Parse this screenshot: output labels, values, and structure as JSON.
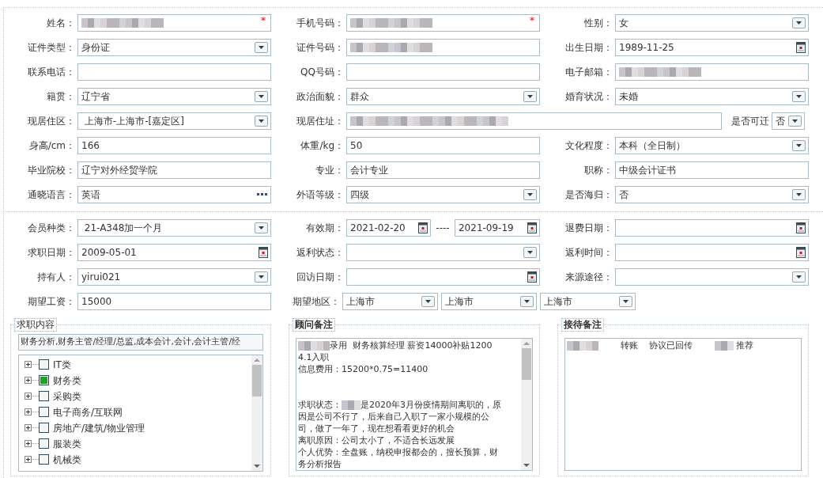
{
  "sections": [
    {
      "rows": [
        {
          "fields": [
            {
              "label": "姓名：",
              "kind": "text",
              "redacted": true,
              "required_mark": "*"
            },
            {
              "label": "手机号码：",
              "kind": "text",
              "redacted": true,
              "required_mark": "*"
            },
            {
              "label": "性别：",
              "kind": "select",
              "value": "女"
            }
          ]
        },
        {
          "fields": [
            {
              "label": "证件类型：",
              "kind": "select",
              "value": "身份证"
            },
            {
              "label": "证件号码：",
              "kind": "text",
              "redacted": true
            },
            {
              "label": "出生日期：",
              "kind": "date",
              "value": "1989-11-25"
            }
          ]
        },
        {
          "fields": [
            {
              "label": "联系电话：",
              "kind": "text"
            },
            {
              "label": "QQ号码：",
              "kind": "text"
            },
            {
              "label": "电子邮箱：",
              "kind": "text",
              "redacted": true
            }
          ]
        },
        {
          "fields": [
            {
              "label": "籍贯：",
              "kind": "select",
              "value": "辽宁省"
            },
            {
              "label": "政治面貌：",
              "kind": "select",
              "value": "群众"
            },
            {
              "label": "婚育状况：",
              "kind": "select",
              "value": "未婚"
            }
          ]
        },
        {
          "fields": [
            {
              "label": "现居住区：",
              "kind": "select",
              "value": " 上海市-上海市-[嘉定区]"
            },
            {
              "label": "现居住址：",
              "kind": "wide_text",
              "redacted": true
            },
            {
              "label": "是否可迁",
              "kind": "compact_select",
              "value": "否"
            }
          ]
        },
        {
          "fields": [
            {
              "label": "身高/cm：",
              "kind": "text",
              "value": "166"
            },
            {
              "label": "体重/kg：",
              "kind": "text",
              "value": "50"
            },
            {
              "label": "文化程度：",
              "kind": "select",
              "value": "本科（全日制）"
            }
          ]
        },
        {
          "fields": [
            {
              "label": "毕业院校：",
              "kind": "text",
              "value": "辽宁对外经贸学院"
            },
            {
              "label": "专业：",
              "kind": "text",
              "value": "会计专业"
            },
            {
              "label": "职称：",
              "kind": "text",
              "value": "中级会计证书"
            }
          ]
        },
        {
          "fields": [
            {
              "label": "通晓语言：",
              "kind": "picker",
              "value": "英语"
            },
            {
              "label": "外语等级：",
              "kind": "select",
              "value": "四级"
            },
            {
              "label": "是否海归：",
              "kind": "select",
              "value": "否"
            }
          ]
        }
      ]
    },
    {
      "rows": [
        {
          "fields": [
            {
              "label": "会员种类：",
              "kind": "select",
              "value": " 21-A348加一个月"
            },
            {
              "label": "有效期：",
              "kind": "date_range",
              "values": [
                "2021-02-20",
                "2021-09-19"
              ],
              "separator": "----"
            },
            {
              "label": "退费日期：",
              "kind": "date"
            }
          ]
        },
        {
          "fields": [
            {
              "label": "求职日期：",
              "kind": "date",
              "value": "2009-05-01"
            },
            {
              "label": "返利状态：",
              "kind": "select"
            },
            {
              "label": "返利时间：",
              "kind": "date"
            }
          ]
        },
        {
          "fields": [
            {
              "label": "持有人：",
              "kind": "select",
              "value": "yirui021"
            },
            {
              "label": "回访日期：",
              "kind": "date"
            },
            {
              "label": "来源途径：",
              "kind": "select"
            }
          ]
        },
        {
          "fields": [
            {
              "label": "期望工资：",
              "kind": "text",
              "value": "15000"
            },
            {
              "label": "期望地区：",
              "kind": "multi_select",
              "values": [
                "上海市",
                "上海市",
                "上海市"
              ]
            }
          ]
        }
      ]
    }
  ],
  "job_content": {
    "legend": "求职内容",
    "emphasized": false,
    "summary": "财务分析,财务主管/经理/总监,成本会计,会计,会计主管/经",
    "tree": [
      {
        "label": "IT类",
        "checked": false
      },
      {
        "label": "财务类",
        "checked": true
      },
      {
        "label": "采购类",
        "checked": false
      },
      {
        "label": "电子商务/互联网",
        "checked": false
      },
      {
        "label": "房地产/建筑/物业管理",
        "checked": false
      },
      {
        "label": "服装类",
        "checked": false
      },
      {
        "label": "机械类",
        "checked": false
      }
    ]
  },
  "notes": [
    {
      "legend": "顾问备注",
      "emphasized": true,
      "scrollable": true,
      "paragraphs": [
        {
          "parts": [
            {
              "kind": "redacted"
            },
            {
              "kind": "text",
              "text": "录用  财务核算经理 薪资14000补贴1200"
            }
          ]
        },
        {
          "parts": [
            {
              "kind": "text",
              "text": "4.1入职"
            }
          ]
        },
        {
          "parts": [
            {
              "kind": "text",
              "text": "信息费用：15200*0.75=11400"
            }
          ]
        },
        {
          "parts": [
            {
              "kind": "spacer"
            }
          ]
        },
        {
          "parts": [
            {
              "kind": "spacer"
            }
          ]
        },
        {
          "parts": [
            {
              "kind": "text",
              "text": "求职状态："
            },
            {
              "kind": "redacted"
            },
            {
              "kind": "text",
              "text": "是2020年3月份疫情期间离职的，原"
            }
          ]
        },
        {
          "parts": [
            {
              "kind": "text",
              "text": "因是公司不行了，后来自己入职了一家小规模的公"
            }
          ]
        },
        {
          "parts": [
            {
              "kind": "text",
              "text": "司，做了一年了，现在想看看更好的机会"
            }
          ]
        },
        {
          "parts": [
            {
              "kind": "text",
              "text": "离职原因：公司太小了，不适合长远发展"
            }
          ]
        },
        {
          "parts": [
            {
              "kind": "text",
              "text": "个人优势：全盘账，纳税申报都会的，擅长预算，财"
            }
          ]
        },
        {
          "parts": [
            {
              "kind": "text",
              "text": "务分析报告"
            }
          ]
        }
      ]
    },
    {
      "legend": "接待备注",
      "emphasized": true,
      "scrollable": false,
      "paragraphs": [
        {
          "parts": [
            {
              "kind": "redacted"
            },
            {
              "kind": "text",
              "text": "        转账    协议已回传        "
            },
            {
              "kind": "redacted"
            },
            {
              "kind": "text",
              "text": " 推荐"
            }
          ]
        }
      ]
    }
  ]
}
